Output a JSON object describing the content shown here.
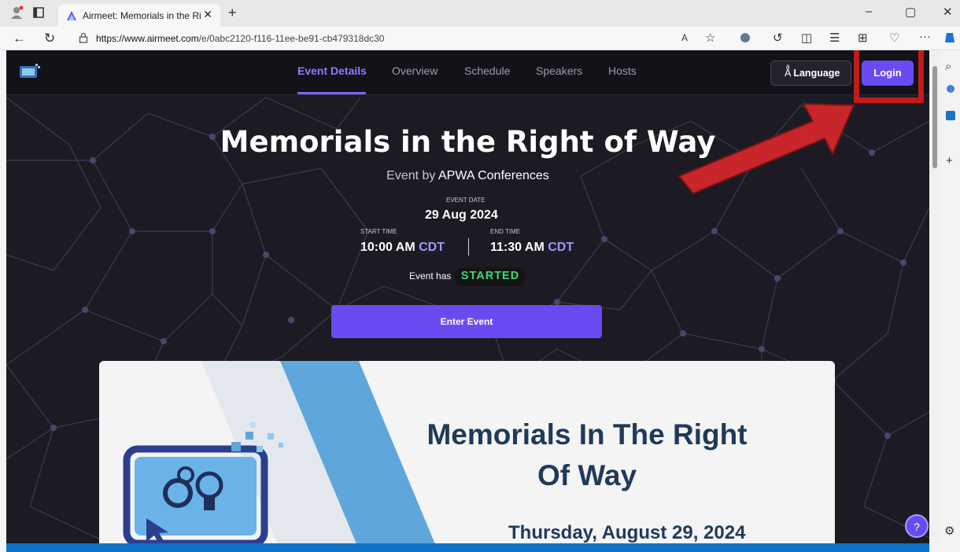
{
  "browser": {
    "tab_title": "Airmeet: Memorials in the Right of Way",
    "tab_close": "✕",
    "new_tab": "+",
    "url_host": "https://www.airmeet.com",
    "url_path": "/e/0abc2120-f116-11ee-be91-cb479318dc30",
    "window_minimize": "–",
    "window_maximize": "▢",
    "window_close": "✕",
    "back": "←",
    "reload": "↻",
    "more": "···"
  },
  "nav": {
    "links": [
      "Event Details",
      "Overview",
      "Schedule",
      "Speakers",
      "Hosts"
    ],
    "language_label": "Language",
    "login_label": "Login"
  },
  "event": {
    "title": "Memorials in the Right of Way",
    "by_prefix": "Event by",
    "organizer": "APWA Conferences",
    "date_label": "EVENT DATE",
    "date_value": "29 Aug 2024",
    "start_label": "START TIME",
    "start_time": "10:00 AM",
    "start_tz": "CDT",
    "end_label": "END TIME",
    "end_time": "11:30 AM",
    "end_tz": "CDT",
    "status_prefix": "Event has",
    "status": "STARTED",
    "enter_label": "Enter Event"
  },
  "banner": {
    "title_line1": "Memorials In The Right",
    "title_line2": "Of Way",
    "date": "Thursday, August 29, 2024"
  },
  "help_label": "?",
  "colors": {
    "accent": "#6a4bf1",
    "started": "#3dd97a",
    "highlight": "#c31a1a"
  }
}
